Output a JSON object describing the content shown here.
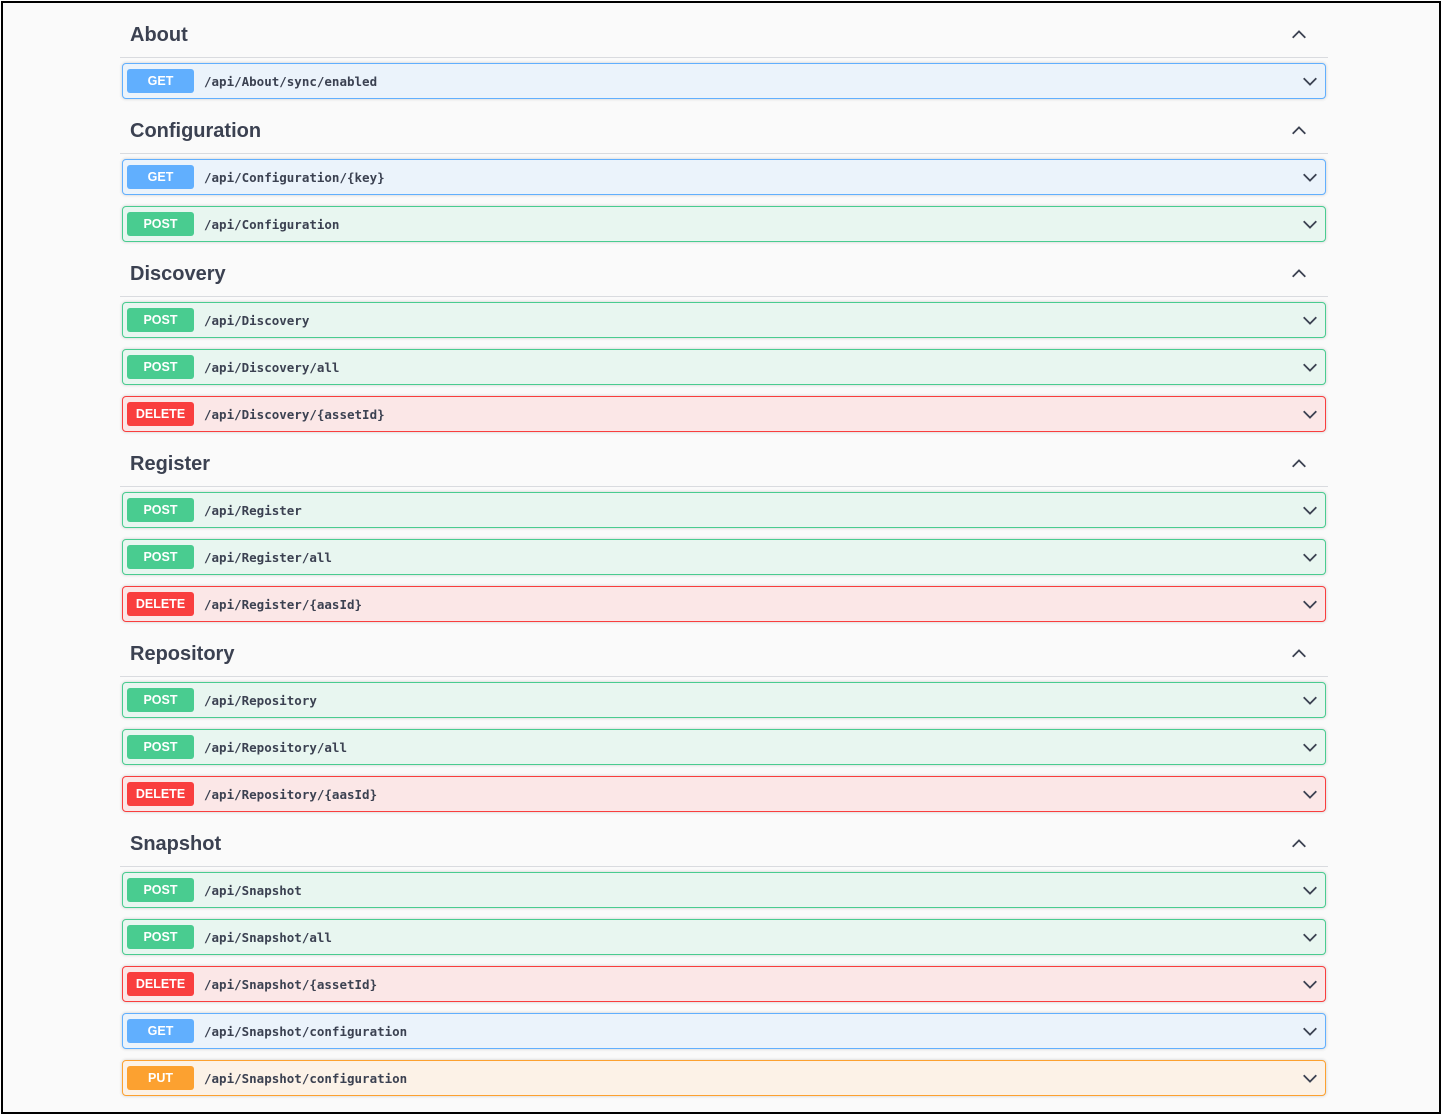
{
  "sections": [
    {
      "title": "About",
      "ops": [
        {
          "method": "GET",
          "path": "/api/About/sync/enabled"
        }
      ]
    },
    {
      "title": "Configuration",
      "ops": [
        {
          "method": "GET",
          "path": "/api/Configuration/{key}"
        },
        {
          "method": "POST",
          "path": "/api/Configuration"
        }
      ]
    },
    {
      "title": "Discovery",
      "ops": [
        {
          "method": "POST",
          "path": "/api/Discovery"
        },
        {
          "method": "POST",
          "path": "/api/Discovery/all"
        },
        {
          "method": "DELETE",
          "path": "/api/Discovery/{assetId}"
        }
      ]
    },
    {
      "title": "Register",
      "ops": [
        {
          "method": "POST",
          "path": "/api/Register"
        },
        {
          "method": "POST",
          "path": "/api/Register/all"
        },
        {
          "method": "DELETE",
          "path": "/api/Register/{aasId}"
        }
      ]
    },
    {
      "title": "Repository",
      "ops": [
        {
          "method": "POST",
          "path": "/api/Repository"
        },
        {
          "method": "POST",
          "path": "/api/Repository/all"
        },
        {
          "method": "DELETE",
          "path": "/api/Repository/{aasId}"
        }
      ]
    },
    {
      "title": "Snapshot",
      "ops": [
        {
          "method": "POST",
          "path": "/api/Snapshot"
        },
        {
          "method": "POST",
          "path": "/api/Snapshot/all"
        },
        {
          "method": "DELETE",
          "path": "/api/Snapshot/{assetId}"
        },
        {
          "method": "GET",
          "path": "/api/Snapshot/configuration"
        },
        {
          "method": "PUT",
          "path": "/api/Snapshot/configuration"
        }
      ]
    }
  ],
  "icons": {
    "section_toggle": "chevron-up-icon",
    "op_toggle": "chevron-down-icon"
  },
  "colors": {
    "get": "#61affe",
    "post": "#49cc90",
    "delete": "#f93e3e",
    "put": "#fca130"
  }
}
